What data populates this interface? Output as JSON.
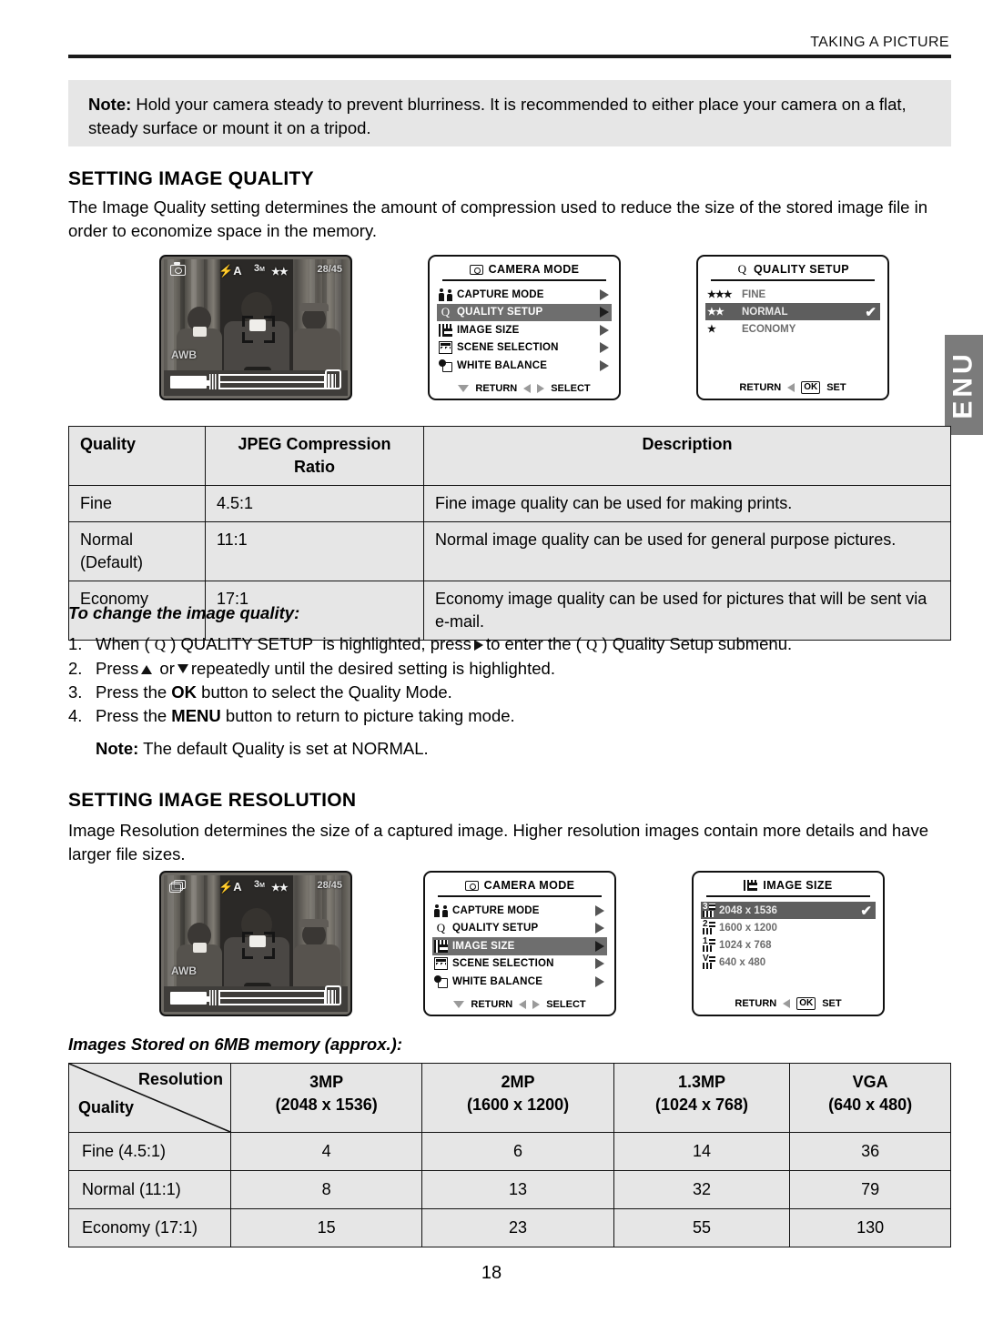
{
  "header": {
    "title": "TAKING A PICTURE"
  },
  "side_tab": {
    "label": "ENU"
  },
  "note_top": {
    "label": "Note:",
    "text": " Hold your camera steady to prevent blurriness. It is recommended to either place your camera on a flat, steady surface or mount it on a tripod."
  },
  "quality_section": {
    "heading": "SETTING IMAGE QUALITY",
    "intro": "The Image Quality setting determines the amount of compression used to reduce the size of the stored image file in order to economize space in the memory.",
    "lcd": {
      "size_num": "3",
      "size_unit": "M",
      "stars": "★★",
      "flash": "A",
      "count": "28/45",
      "awb": "AWB"
    },
    "camera_mode_menu": {
      "title": "CAMERA MODE",
      "items": [
        {
          "label": "CAPTURE MODE",
          "icon": "people-icon",
          "selected": false
        },
        {
          "label": "QUALITY SETUP",
          "icon": "q-icon",
          "selected": true
        },
        {
          "label": "IMAGE SIZE",
          "icon": "grid-icon",
          "selected": false
        },
        {
          "label": "SCENE SELECTION",
          "icon": "scene-icon",
          "selected": false
        },
        {
          "label": "WHITE BALANCE",
          "icon": "white-balance-icon",
          "selected": false
        }
      ],
      "footer_return": "RETURN",
      "footer_select": "SELECT"
    },
    "quality_setup_menu": {
      "title": "QUALITY  SETUP",
      "title_icon": "Q",
      "items": [
        {
          "stars": "★★★",
          "label": "FINE",
          "selected": false,
          "checked": false
        },
        {
          "stars": "★★",
          "label": "NORMAL",
          "selected": true,
          "checked": true
        },
        {
          "stars": "★",
          "label": "ECONOMY",
          "selected": false,
          "checked": false
        }
      ],
      "footer_return": "RETURN",
      "footer_ok": "OK",
      "footer_set": "SET"
    },
    "table": {
      "headers": [
        "Quality",
        "JPEG Compression Ratio",
        "Description"
      ],
      "rows": [
        [
          "Fine",
          "4.5:1",
          "Fine image quality can be used for making prints."
        ],
        [
          "Normal\n(Default)",
          "11:1",
          "Normal image quality can be used for general purpose pictures."
        ],
        [
          "Economy",
          "17:1",
          "Economy image quality can be used for pictures that will be sent via e-mail."
        ]
      ]
    },
    "howto_title": "To change the image quality:",
    "steps": [
      {
        "n": "1.",
        "pre": "When (",
        "q": "Q",
        "mid": ") QUALITY SETUP  is highlighted, press",
        "tri": "right",
        "post": "to enter the (",
        "q2": "Q",
        "tail": ") Quality Setup submenu."
      },
      {
        "n": "2.",
        "pre": "Press",
        "tri": "up",
        "mid": "or",
        "tri2": "down",
        "post": "repeatedly until the desired setting is highlighted."
      },
      {
        "n": "3.",
        "pre": "Press the ",
        "bold": "OK",
        "post": " button to select the Quality Mode."
      },
      {
        "n": "4.",
        "pre": "Press the ",
        "bold": "MENU",
        "post": " button to return to picture taking mode."
      }
    ],
    "note_bottom_label": "Note:",
    "note_bottom_text": " The default Quality is set at NORMAL."
  },
  "resolution_section": {
    "heading": "SETTING IMAGE RESOLUTION",
    "intro": "Image Resolution determines the size of a captured image. Higher resolution images contain more details and have larger file sizes.",
    "lcd": {
      "size_num": "3",
      "size_unit": "M",
      "stars": "★★",
      "flash": "A",
      "count": "28/45",
      "awb": "AWB"
    },
    "camera_mode_menu": {
      "title": "CAMERA MODE",
      "items": [
        {
          "label": "CAPTURE MODE",
          "icon": "people-icon",
          "selected": false
        },
        {
          "label": "QUALITY SETUP",
          "icon": "q-icon",
          "selected": false
        },
        {
          "label": "IMAGE SIZE",
          "icon": "grid-icon",
          "selected": true
        },
        {
          "label": "SCENE SELECTION",
          "icon": "scene-icon",
          "selected": false
        },
        {
          "label": "WHITE BALANCE",
          "icon": "white-balance-icon",
          "selected": false
        }
      ],
      "footer_return": "RETURN",
      "footer_select": "SELECT"
    },
    "image_size_menu": {
      "title": "IMAGE SIZE",
      "items": [
        {
          "badge": "3",
          "label": "2048 x 1536",
          "selected": true,
          "checked": true
        },
        {
          "badge": "2",
          "label": "1600 x 1200",
          "selected": false,
          "checked": false
        },
        {
          "badge": "1",
          "label": "1024 x 768",
          "selected": false,
          "checked": false
        },
        {
          "badge": "V",
          "label": "640 x 480",
          "selected": false,
          "checked": false
        }
      ],
      "footer_return": "RETURN",
      "footer_ok": "OK",
      "footer_set": "SET"
    },
    "table_caption": "Images Stored on 6MB memory (approx.):",
    "table": {
      "corner_top": "Resolution",
      "corner_bottom": "Quality",
      "columns": [
        {
          "title": "3MP",
          "sub": "(2048 x 1536)"
        },
        {
          "title": "2MP",
          "sub": "(1600 x 1200)"
        },
        {
          "title": "1.3MP",
          "sub": "(1024 x 768)"
        },
        {
          "title": "VGA",
          "sub": "(640 x 480)"
        }
      ],
      "rows": [
        {
          "label": "Fine (4.5:1)",
          "values": [
            "4",
            "6",
            "14",
            "36"
          ]
        },
        {
          "label": "Normal (11:1)",
          "values": [
            "8",
            "13",
            "32",
            "79"
          ]
        },
        {
          "label": "Economy (17:1)",
          "values": [
            "15",
            "23",
            "55",
            "130"
          ]
        }
      ]
    }
  },
  "page_number": "18"
}
